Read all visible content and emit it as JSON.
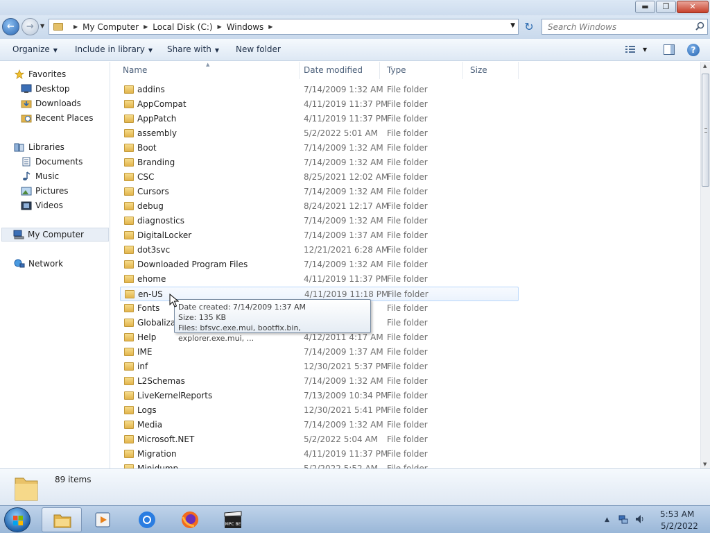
{
  "window": {
    "minimize": "▬",
    "maximize": "❐",
    "close": "✕"
  },
  "address": {
    "breadcrumbs": [
      "My Computer",
      "Local Disk (C:)",
      "Windows"
    ],
    "search_placeholder": "Search Windows"
  },
  "toolbar": {
    "organize": "Organize",
    "include_in_library": "Include in library",
    "share_with": "Share with",
    "new_folder": "New folder"
  },
  "nav": {
    "favorites": "Favorites",
    "desktop": "Desktop",
    "downloads": "Downloads",
    "recent_places": "Recent Places",
    "libraries": "Libraries",
    "documents": "Documents",
    "music": "Music",
    "pictures": "Pictures",
    "videos": "Videos",
    "my_computer": "My Computer",
    "network": "Network"
  },
  "columns": {
    "name": "Name",
    "date_modified": "Date modified",
    "type": "Type",
    "size": "Size"
  },
  "files": [
    {
      "name": "addins",
      "date": "7/14/2009 1:32 AM",
      "type": "File folder"
    },
    {
      "name": "AppCompat",
      "date": "4/11/2019 11:37 PM",
      "type": "File folder"
    },
    {
      "name": "AppPatch",
      "date": "4/11/2019 11:37 PM",
      "type": "File folder"
    },
    {
      "name": "assembly",
      "date": "5/2/2022 5:01 AM",
      "type": "File folder"
    },
    {
      "name": "Boot",
      "date": "7/14/2009 1:32 AM",
      "type": "File folder"
    },
    {
      "name": "Branding",
      "date": "7/14/2009 1:32 AM",
      "type": "File folder"
    },
    {
      "name": "CSC",
      "date": "8/25/2021 12:02 AM",
      "type": "File folder"
    },
    {
      "name": "Cursors",
      "date": "7/14/2009 1:32 AM",
      "type": "File folder"
    },
    {
      "name": "debug",
      "date": "8/24/2021 12:17 AM",
      "type": "File folder"
    },
    {
      "name": "diagnostics",
      "date": "7/14/2009 1:32 AM",
      "type": "File folder"
    },
    {
      "name": "DigitalLocker",
      "date": "7/14/2009 1:37 AM",
      "type": "File folder"
    },
    {
      "name": "dot3svc",
      "date": "12/21/2021 6:28 AM",
      "type": "File folder"
    },
    {
      "name": "Downloaded Program Files",
      "date": "7/14/2009 1:32 AM",
      "type": "File folder"
    },
    {
      "name": "ehome",
      "date": "4/11/2019 11:37 PM",
      "type": "File folder"
    },
    {
      "name": "en-US",
      "date": "4/11/2019 11:18 PM",
      "type": "File folder"
    },
    {
      "name": "Fonts",
      "date": "",
      "type": "File folder"
    },
    {
      "name": "Globalizat",
      "date": "",
      "type": "File folder"
    },
    {
      "name": "Help",
      "date": "4/12/2011 4:17 AM",
      "type": "File folder"
    },
    {
      "name": "IME",
      "date": "7/14/2009 1:37 AM",
      "type": "File folder"
    },
    {
      "name": "inf",
      "date": "12/30/2021 5:37 PM",
      "type": "File folder"
    },
    {
      "name": "L2Schemas",
      "date": "7/14/2009 1:32 AM",
      "type": "File folder"
    },
    {
      "name": "LiveKernelReports",
      "date": "7/13/2009 10:34 PM",
      "type": "File folder"
    },
    {
      "name": "Logs",
      "date": "12/30/2021 5:41 PM",
      "type": "File folder"
    },
    {
      "name": "Media",
      "date": "7/14/2009 1:32 AM",
      "type": "File folder"
    },
    {
      "name": "Microsoft.NET",
      "date": "5/2/2022 5:04 AM",
      "type": "File folder"
    },
    {
      "name": "Migration",
      "date": "4/11/2019 11:37 PM",
      "type": "File folder"
    },
    {
      "name": "Minidump",
      "date": "5/2/2022 5:52 AM",
      "type": "File folder"
    }
  ],
  "tooltip": {
    "date_created": "Date created: 7/14/2009 1:37 AM",
    "size": "Size: 135 KB",
    "files": "Files: bfsvc.exe.mui, bootfix.bin, explorer.exe.mui, ..."
  },
  "status": {
    "item_count": "89 items"
  },
  "taskbar": {
    "time": "5:53 AM",
    "date": "5/2/2022",
    "mpc_label": "MPC BE"
  },
  "colors": {
    "accent": "#2a66b2",
    "folder": "#e2b44c",
    "hover_border": "#b8d6fb"
  }
}
